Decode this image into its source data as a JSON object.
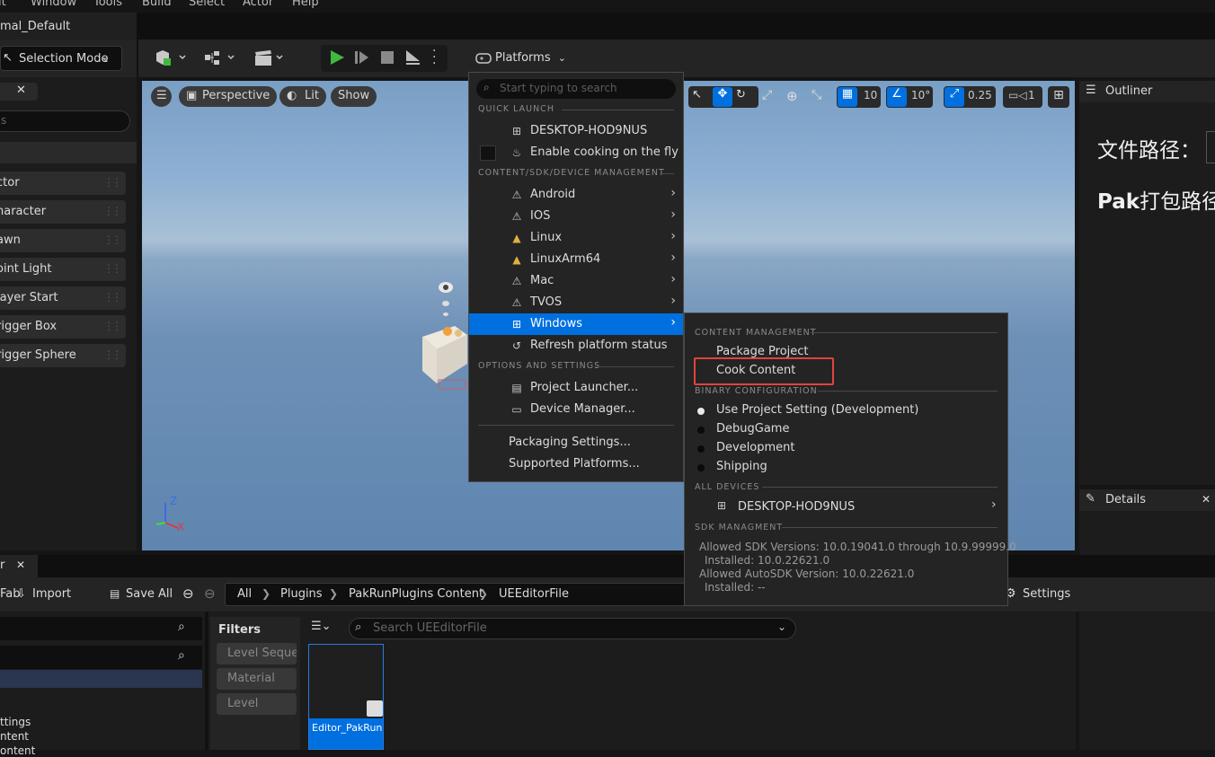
{
  "menubar": {
    "items": [
      "it",
      "Window",
      "Tools",
      "Build",
      "Select",
      "Actor",
      "Help"
    ]
  },
  "level_tab": {
    "label": "mal_Default"
  },
  "toolbar": {
    "selection_mode": "Selection Mode",
    "platforms": "Platforms"
  },
  "place_actors": {
    "search_placeholder": "s",
    "items": [
      "ctor",
      "haracter",
      "awn",
      "oint Light",
      "layer Start",
      "rigger Box",
      "rigger Sphere"
    ]
  },
  "viewport": {
    "perspective": "Perspective",
    "lit": "Lit",
    "show": "Show",
    "grid_size": "10",
    "rotation_snap": "10°",
    "scale_snap": "0.25",
    "camera_speed": "1",
    "axis_z": "Z",
    "axis_x": "X"
  },
  "outliner": {
    "title": "Outliner",
    "text_line1": "文件路径：",
    "text_line2_bold": "Pak",
    "text_line2": "打包路径"
  },
  "details": {
    "title": "Details"
  },
  "content_browser": {
    "tab_label": "r",
    "fab": "Fab",
    "import": "Import",
    "save_all": "Save All",
    "breadcrumbs": [
      "All",
      "Plugins",
      "PakRunPlugins Content",
      "UEEditorFile"
    ],
    "settings": "Settings",
    "filters_title": "Filters",
    "filters": [
      "Level Sequer",
      "Material",
      "Level"
    ],
    "search_placeholder": "Search UEEditorFile",
    "tree_items": [
      "ttings",
      "ntent",
      "ontent"
    ],
    "asset_name": "Editor_PakRun"
  },
  "platforms_menu": {
    "search_placeholder": "Start typing to search",
    "quick_launch_header": "QUICK LAUNCH",
    "device": "DESKTOP-HOD9NUS",
    "cook_on_fly": "Enable cooking on the fly",
    "mgmt_header": "CONTENT/SDK/DEVICE MANAGEMENT",
    "platforms": [
      "Android",
      "IOS",
      "Linux",
      "LinuxArm64",
      "Mac",
      "TVOS",
      "Windows"
    ],
    "refresh": "Refresh platform status",
    "options_header": "OPTIONS AND SETTINGS",
    "project_launcher": "Project Launcher...",
    "device_manager": "Device Manager...",
    "packaging_settings": "Packaging Settings...",
    "supported_platforms": "Supported Platforms..."
  },
  "windows_submenu": {
    "content_mgmt_header": "CONTENT MANAGEMENT",
    "package_project": "Package Project",
    "cook_content": "Cook Content",
    "binary_header": "BINARY CONFIGURATION",
    "configs": [
      "Use Project Setting (Development)",
      "DebugGame",
      "Development",
      "Shipping"
    ],
    "selected_config": "Use Project Setting (Development)",
    "all_devices_header": "ALL DEVICES",
    "device": "DESKTOP-HOD9NUS",
    "sdk_header": "SDK MANAGMENT",
    "sdk_line1": "Allowed SDK Versions: 10.0.19041.0 through 10.9.99999.0",
    "sdk_line2": "Installed: 10.0.22621.0",
    "sdk_line3": "Allowed AutoSDK Version: 10.0.22621.0",
    "sdk_line4": "Installed: --"
  },
  "colors": {
    "accent": "#0070e0",
    "highlight_box": "#e0443c",
    "play_green": "#3fb93f"
  }
}
